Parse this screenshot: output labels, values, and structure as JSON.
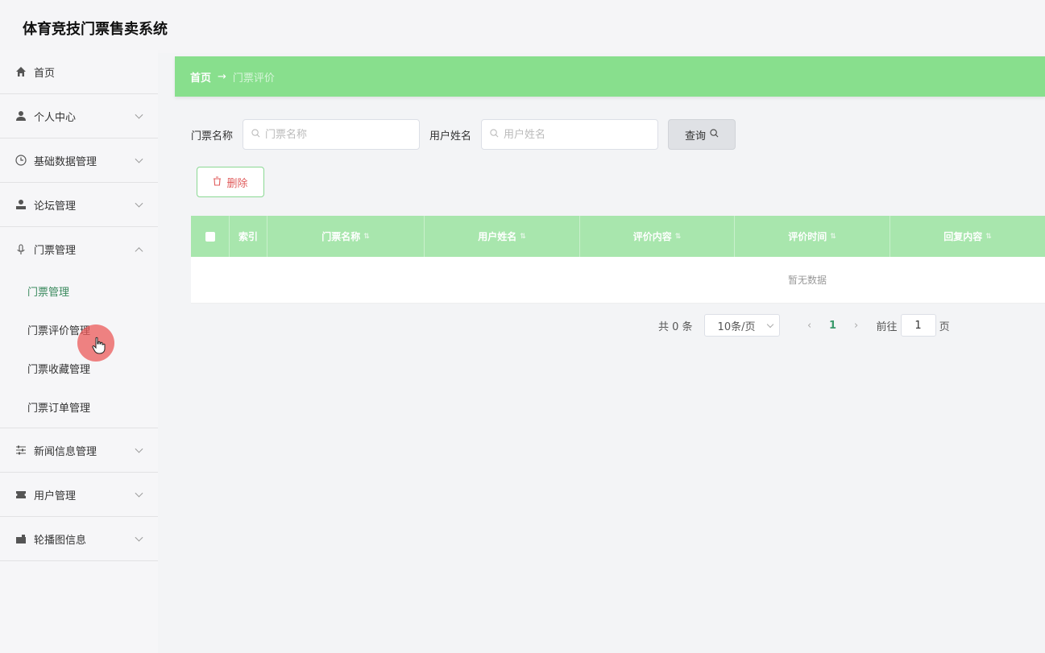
{
  "app": {
    "title": "体育竞技门票售卖系统"
  },
  "sidebar": {
    "items": [
      {
        "label": "首页",
        "icon": "home-icon"
      },
      {
        "label": "个人中心",
        "icon": "user-icon"
      },
      {
        "label": "基础数据管理",
        "icon": "clock-icon"
      },
      {
        "label": "论坛管理",
        "icon": "person-icon"
      },
      {
        "label": "门票管理",
        "icon": "mic-icon"
      },
      {
        "label": "新闻信息管理",
        "icon": "sliders-icon"
      },
      {
        "label": "用户管理",
        "icon": "ticket-icon"
      },
      {
        "label": "轮播图信息",
        "icon": "camera-icon"
      }
    ],
    "submenu": [
      {
        "label": "门票管理"
      },
      {
        "label": "门票评价管理"
      },
      {
        "label": "门票收藏管理"
      },
      {
        "label": "门票订单管理"
      }
    ]
  },
  "breadcrumb": {
    "home": "首页",
    "arrow": "→",
    "current": "门票评价"
  },
  "search": {
    "ticket_label": "门票名称",
    "ticket_placeholder": "门票名称",
    "user_label": "用户姓名",
    "user_placeholder": "用户姓名",
    "button": "查询"
  },
  "actions": {
    "delete": "删除"
  },
  "table": {
    "columns": [
      "索引",
      "门票名称",
      "用户姓名",
      "评价内容",
      "评价时间",
      "回复内容"
    ],
    "empty_text": "暂无数据"
  },
  "pagination": {
    "total": "共 0 条",
    "page_size": "10条/页",
    "current_page": "1",
    "goto_label": "前往",
    "goto_value": "1",
    "page_suffix": "页"
  },
  "colors": {
    "accent": "#88df8d",
    "table_header": "#a8e6ad",
    "danger": "#e05c5c",
    "active_page": "#3a9a6b"
  }
}
